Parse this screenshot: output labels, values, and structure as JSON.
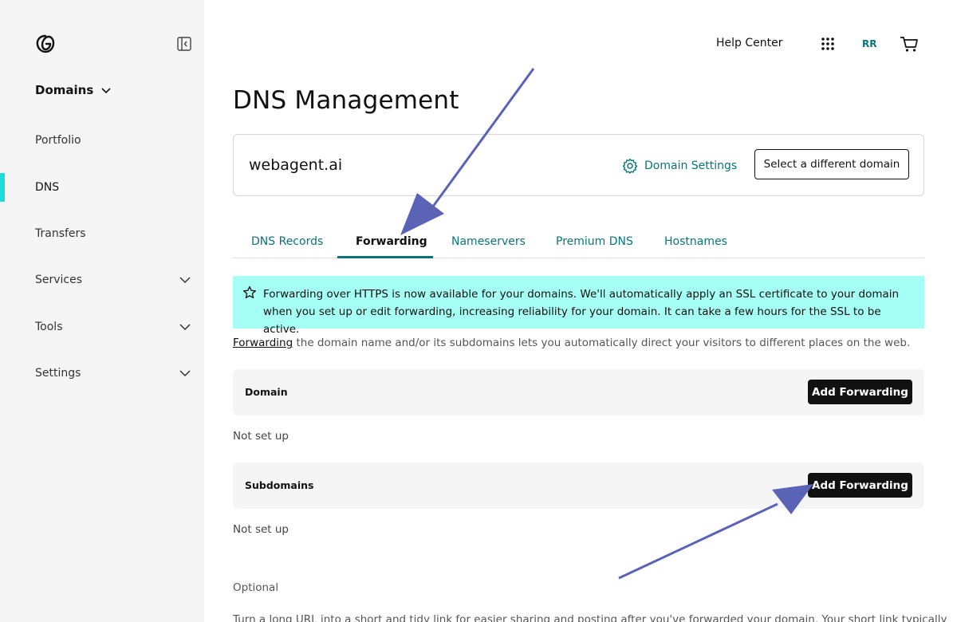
{
  "sidebar": {
    "section_title": "Domains",
    "items": [
      {
        "label": "Portfolio"
      },
      {
        "label": "DNS"
      },
      {
        "label": "Transfers"
      },
      {
        "label": "Services"
      },
      {
        "label": "Tools"
      },
      {
        "label": "Settings"
      }
    ]
  },
  "header": {
    "help_center": "Help Center",
    "avatar_initials": "RR"
  },
  "page": {
    "title": "DNS Management"
  },
  "domain_card": {
    "domain": "webagent.ai",
    "settings_label": "Domain Settings",
    "select_button": "Select a different domain"
  },
  "tabs": [
    {
      "label": "DNS Records"
    },
    {
      "label": "Forwarding"
    },
    {
      "label": "Nameservers"
    },
    {
      "label": "Premium DNS"
    },
    {
      "label": "Hostnames"
    }
  ],
  "banner": {
    "text": "Forwarding over HTTPS is now available for your domains. We'll automatically apply an SSL certificate to your domain when you set up or edit forwarding, increasing reliability for your domain. It can take a few hours for the SSL to be active."
  },
  "intro": {
    "link": "Forwarding",
    "text": " the domain name and/or its subdomains lets you automatically direct your visitors to different places on the web."
  },
  "forwarding": {
    "domain": {
      "label": "Domain",
      "button": "Add Forwarding",
      "status": "Not set up"
    },
    "subdomains": {
      "label": "Subdomains",
      "button": "Add Forwarding",
      "status": "Not set up"
    }
  },
  "optional": {
    "label": "Optional",
    "description": "Turn a long URL into a short and tidy link for easier sharing and posting after you've forwarded your domain. Your short link typically"
  },
  "colors": {
    "accent": "#09757a",
    "active_bar": "#1bdbdb",
    "banner_bg": "#a6fff4",
    "annotation_arrow": "#5b63b7"
  }
}
